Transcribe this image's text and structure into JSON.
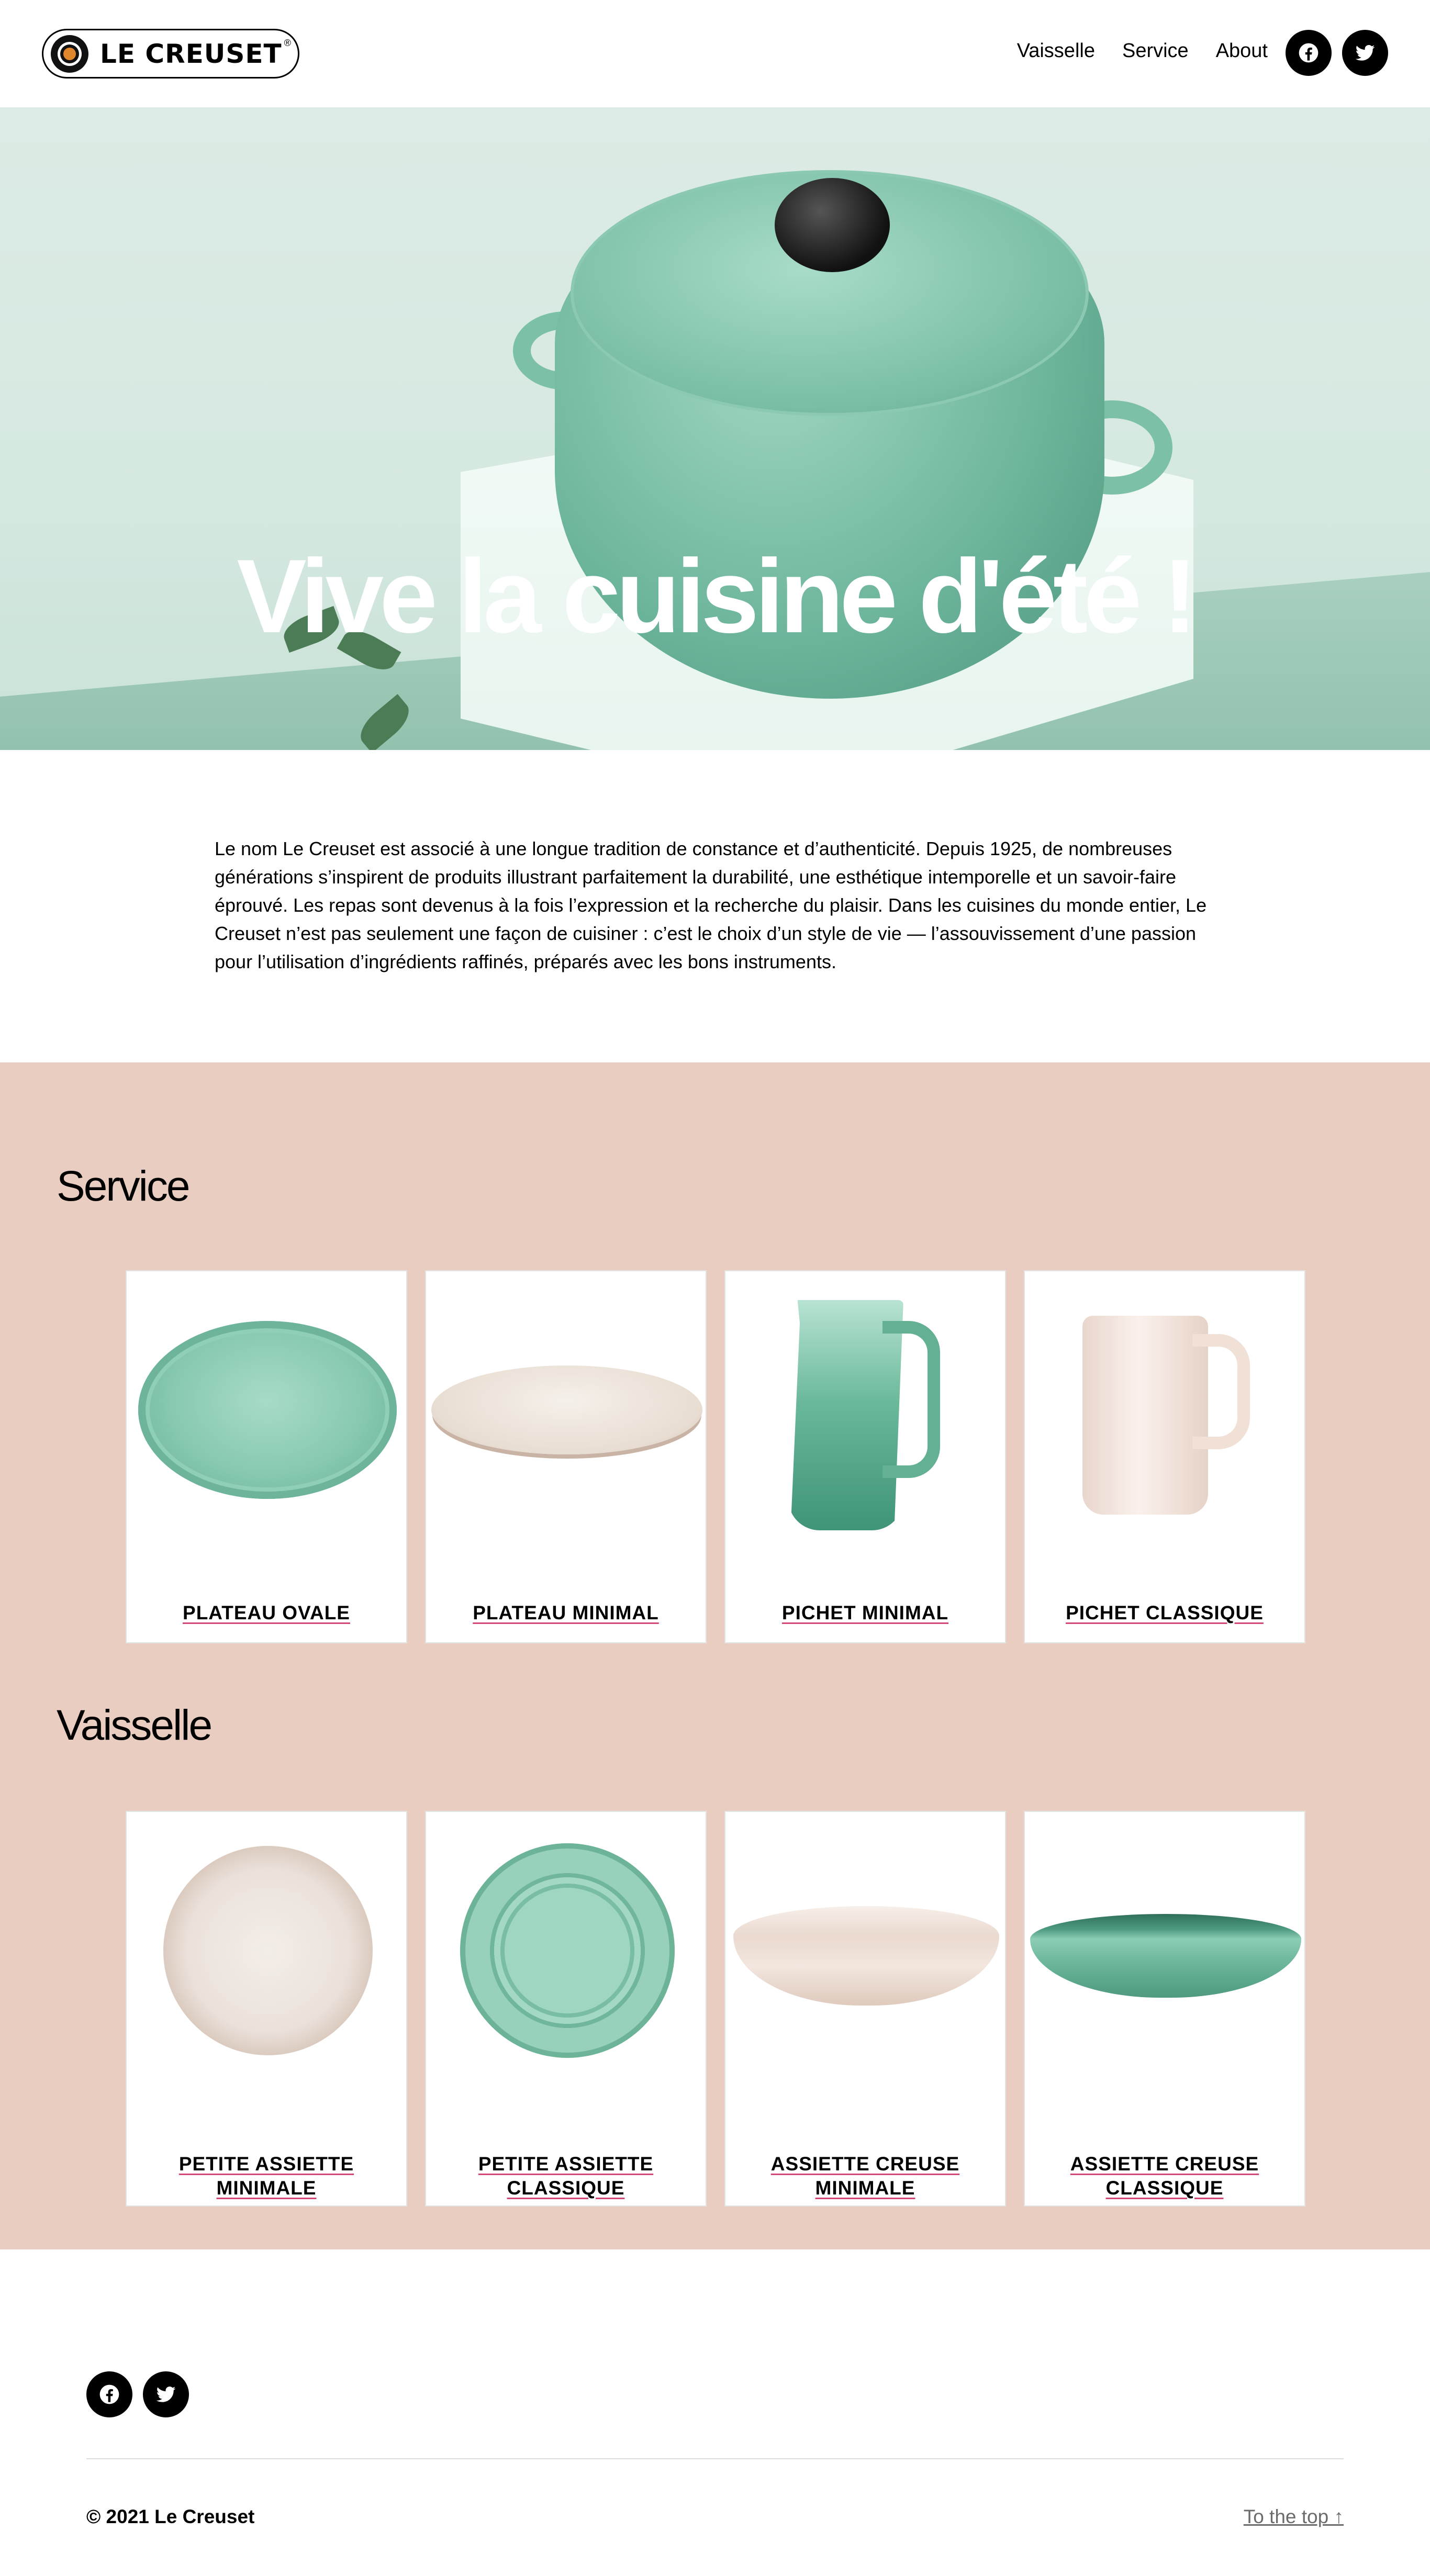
{
  "header": {
    "logo_text": "LE CREUSET",
    "logo_mark": "®",
    "nav": [
      "Vaisselle",
      "Service",
      "About"
    ],
    "social": [
      "facebook-icon",
      "twitter-icon"
    ]
  },
  "hero": {
    "title": "Vive la cuisine d'été !"
  },
  "intro": {
    "text": "Le nom Le Creuset est associé à une longue tradition de constance et d’authenticité. Depuis 1925, de nombreuses générations s’inspirent de produits illustrant parfaitement la durabilité, une esthétique intemporelle et un savoir-faire éprouvé. Les repas sont devenus à la fois l’expression et la recherche du plaisir. Dans les cuisines du monde entier, Le Creuset n’est pas seulement une façon de cuisiner : c’est le choix d’un style de vie — l’assouvissement d’une passion pour l’utilisation d’ingrédients raffinés, préparés avec les bons instruments."
  },
  "sections": [
    {
      "title": "Service",
      "products": [
        {
          "label": "PLATEAU OVALE",
          "shape": "oval-platter",
          "color": "#7bc0a6"
        },
        {
          "label": "PLATEAU MINIMAL",
          "shape": "flat-platter",
          "color": "#ece4dc"
        },
        {
          "label": "PICHET MINIMAL",
          "shape": "pitcher",
          "color": "#5fae92"
        },
        {
          "label": "PICHET CLASSIQUE",
          "shape": "pitcher-classic",
          "color": "#f2e4dc"
        }
      ]
    },
    {
      "title": "Vaisselle",
      "products": [
        {
          "label": "PETITE ASSIETTE MINIMALE",
          "shape": "plate",
          "color": "#eadbd2"
        },
        {
          "label": "PETITE ASSIETTE CLASSIQUE",
          "shape": "plate-ridged",
          "color": "#7cc0a6"
        },
        {
          "label": "ASSIETTE CREUSE MINIMALE",
          "shape": "bowl",
          "color": "#efe0d8"
        },
        {
          "label": "ASSIETTE CREUSE CLASSIQUE",
          "shape": "bowl-ridged",
          "color": "#74bca1"
        }
      ]
    }
  ],
  "footer": {
    "social": [
      "facebook-icon",
      "twitter-icon"
    ],
    "copyright": "© 2021 Le Creuset",
    "to_top": "To the top ↑"
  },
  "colors": {
    "section_bg": "#e8cdc0",
    "link_underline": "#d2487a",
    "sage": "#7bc0a6"
  }
}
